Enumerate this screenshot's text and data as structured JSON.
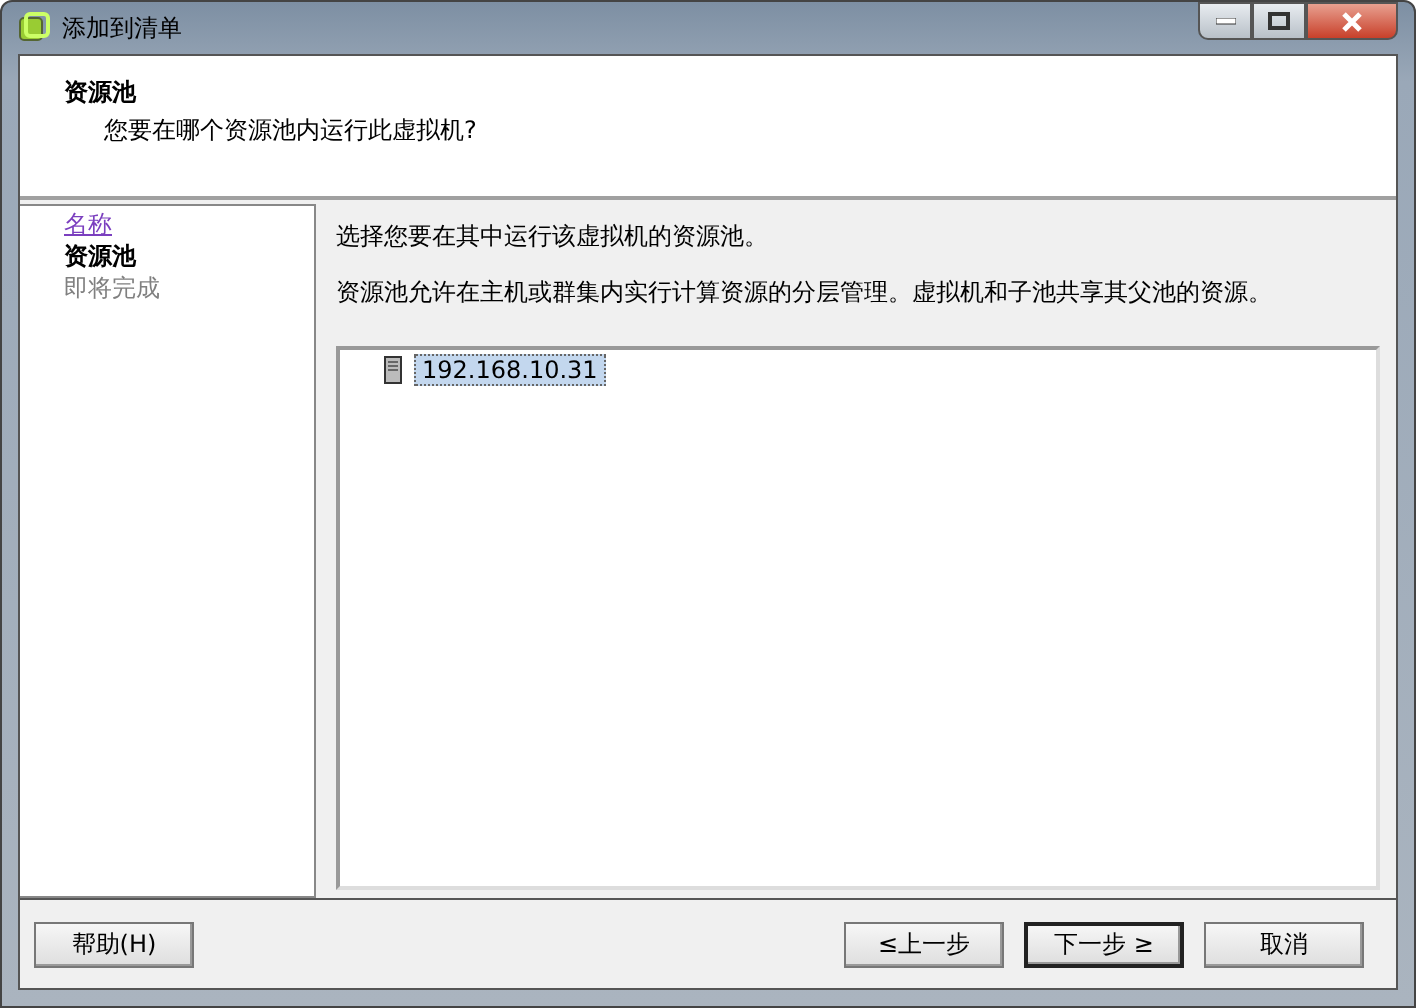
{
  "window": {
    "title": "添加到清单"
  },
  "header": {
    "title": "资源池",
    "subtitle": "您要在哪个资源池内运行此虚拟机?"
  },
  "steps": [
    {
      "label": "名称",
      "kind": "done"
    },
    {
      "label": "资源池",
      "kind": "current"
    },
    {
      "label": "即将完成",
      "kind": "pending"
    }
  ],
  "content": {
    "instruction": "选择您要在其中运行该虚拟机的资源池。",
    "description": "资源池允许在主机或群集内实行计算资源的分层管理。虚拟机和子池共享其父池的资源。"
  },
  "tree": {
    "items": [
      {
        "label": "192.168.10.31",
        "selected": true
      }
    ]
  },
  "buttons": {
    "help": "帮助(H)",
    "back": "≤上一步",
    "next": "下一步 ≥",
    "cancel": "取消"
  }
}
